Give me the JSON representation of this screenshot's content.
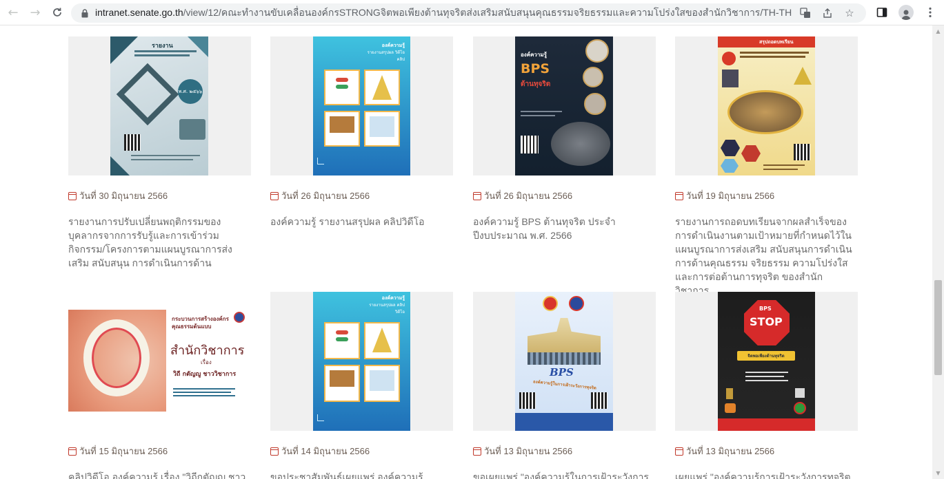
{
  "browser": {
    "url_prefix": "intranet.senate.go.th",
    "url_rest": "/view/12/คณะทำงานขับเคลื่อนองค์กรSTRONGจิตพอเพียงต้านทุจริตส่งเสริมสนับสนุนคุณธรรมจริยธรรมและความโปร่งใสของสำนักวิชาการ/TH-TH"
  },
  "cards": [
    {
      "date": "วันที่ 30 มิถุนายน 2566",
      "title": "รายงานการปรับเปลี่ยนพฤติกรรมของบุคลากรจากการรับรู้และการเข้าร่วมกิจกรรม/โครงการตามแผนบูรณาการส่งเสริม สนับสนุน การดำเนินการด้านคุณธรรม จริยธรรม ความโปร่งใสและการต่อต้านการทุจริตของสำนัก",
      "poster_heading": "รายงาน",
      "poster_year": "พ.ศ. ๒๕๖๖"
    },
    {
      "date": "วันที่ 26 มิถุนายน 2566",
      "title": "องค์ความรู้ รายงานสรุปผล คลิปวิดีโอ",
      "poster_heading": "องค์ความรู้",
      "poster_sub": "รายงานสรุปผล วิดีโอคลิป"
    },
    {
      "date": "วันที่ 26 มิถุนายน 2566",
      "title": "องค์ความรู้ BPS ต้านทุจริต ประจำปีงบประมาณ พ.ศ. 2566",
      "poster_heading": "องค์ความรู้",
      "poster_bps": "BPS",
      "poster_sub": "ต้านทุจริต"
    },
    {
      "date": "วันที่ 19 มิถุนายน 2566",
      "title": "รายงานการถอดบทเรียนจากผลสำเร็จของการดำเนินงานตามเป้าหมายที่กำหนดไว้ในแผนบูรณาการส่งเสริม สนับสนุนการดำเนินการด้านคุณธรรม จริยธรรม ความโปร่งใสและการต่อต้านการทุจริต ของสำนักวิชาการ",
      "poster_heading": "สรุปถอดบทเรียน"
    },
    {
      "date": "วันที่ 15 มิถุนายน 2566",
      "title": "คลิปวิดีโอ องค์ความรู้ เรื่อง \"วิถีกตัญญู ชาว",
      "poster_heading": "กระบวนการสร้างองค์กรคุณธรรมต้นแบบ",
      "poster_main": "สำนักวิชาการ",
      "poster_sub": "เรื่อง",
      "poster_topic": "วิถี กตัญญู ชาววิชาการ"
    },
    {
      "date": "วันที่ 14 มิถุนายน 2566",
      "title": "ขอประชาสัมพันธ์เผยแพร่ องค์ความรู้ รายงาน",
      "poster_heading": "องค์ความรู้",
      "poster_sub": "รายงานสรุปผล คลิปวิดีโอ"
    },
    {
      "date": "วันที่ 13 มิถุนายน 2566",
      "title": "ขอเผยแพร่ \"องค์ความรู้ในการเฝ้าระวังการ",
      "poster_bps": "BPS",
      "poster_sub": "องค์ความรู้ในการเฝ้าระวังการทุจริต"
    },
    {
      "date": "วันที่ 13 มิถุนายน 2566",
      "title": "เผยแพร่ \"องค์ความรู้การเฝ้าระวังการทุจริตของ",
      "poster_bps": "BPS",
      "poster_stop": "STOP",
      "poster_sub": "จิตพอเพียงต้านทุจริต"
    }
  ],
  "colors": {
    "accent": "#c0392b",
    "text": "#6b6b6b"
  }
}
